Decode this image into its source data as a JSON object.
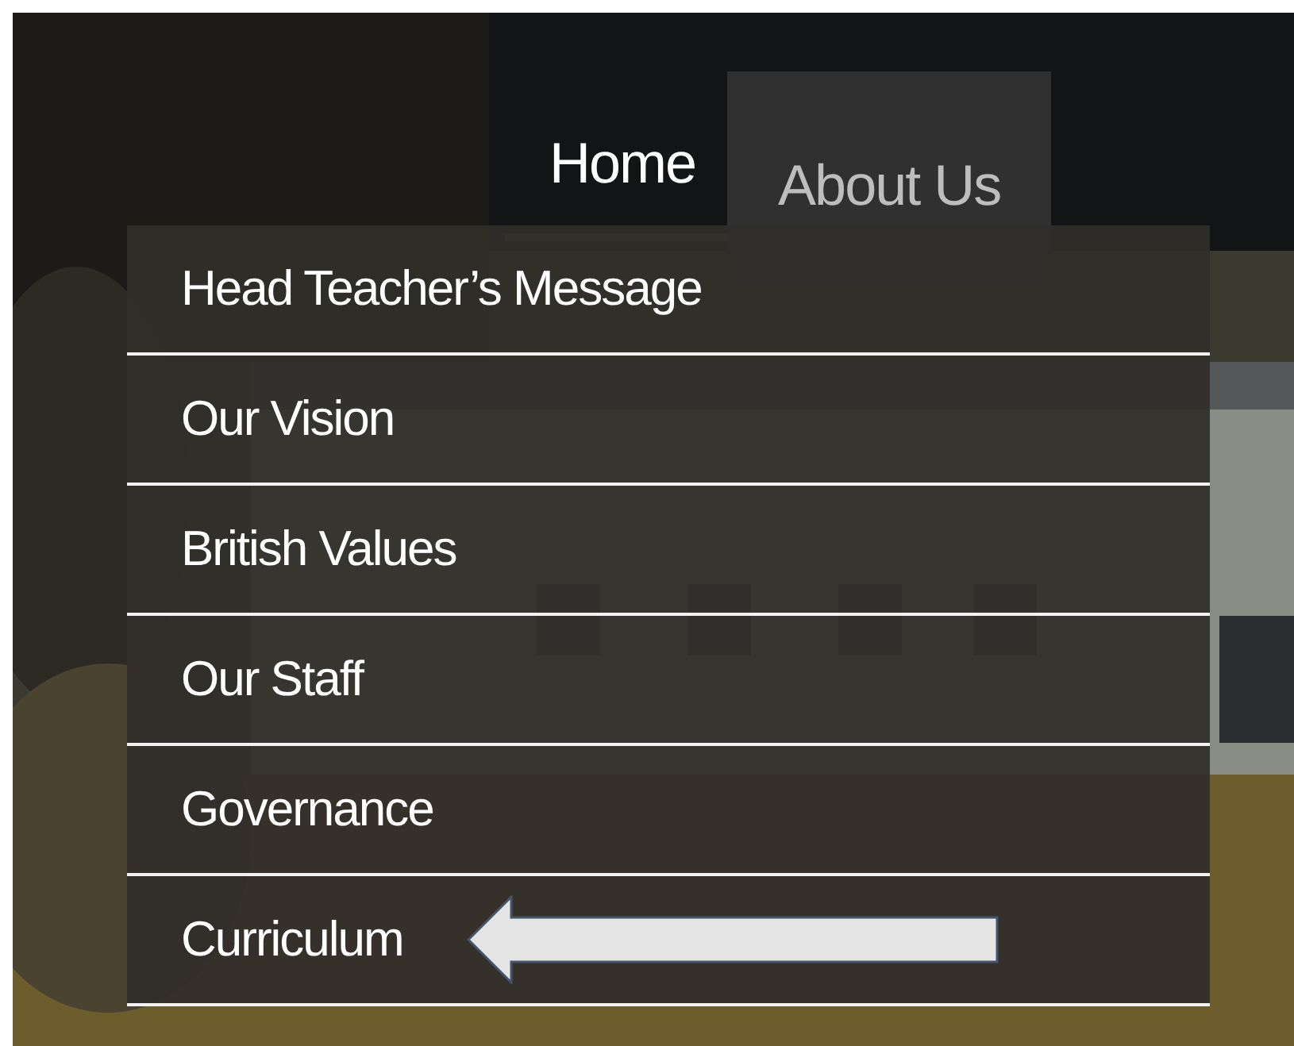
{
  "nav": {
    "items": [
      {
        "label": "Home",
        "selected": false,
        "current": true
      },
      {
        "label": "About Us",
        "selected": true,
        "current": false
      }
    ]
  },
  "dropdown": {
    "items": [
      {
        "label": "Head Teacher’s Message",
        "pointed": false
      },
      {
        "label": "Our Vision",
        "pointed": false
      },
      {
        "label": "British Values",
        "pointed": false
      },
      {
        "label": "Our Staff",
        "pointed": false
      },
      {
        "label": "Governance",
        "pointed": false
      },
      {
        "label": "Curriculum",
        "pointed": true
      }
    ]
  }
}
